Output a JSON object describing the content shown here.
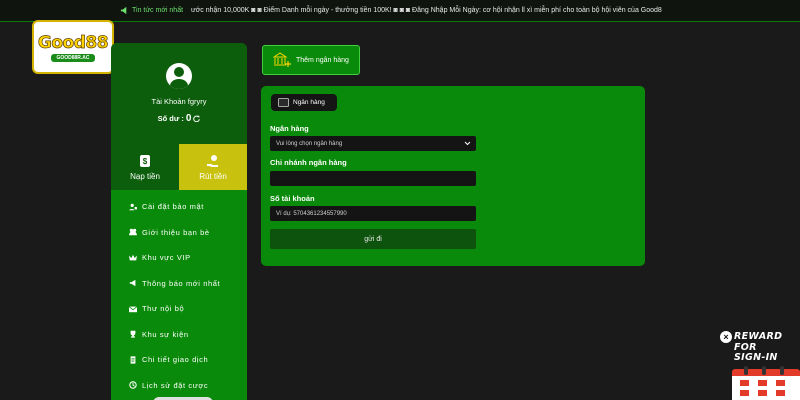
{
  "ticker": {
    "label": "Tin tức mới nhất",
    "text": "ước nhận 10,000K  ◙  ◙  Điểm Danh mỗi ngày - thưởng tiền 100K!  ◙  ◙  ◙  Đăng Nhập Mỗi Ngày: cơ hội nhận ll xì miễn phí cho toàn bộ hội viên của Good8"
  },
  "logo": {
    "main": "Good88",
    "sub": "GOOD88R.AC"
  },
  "profile": {
    "account_name": "Tài Khoản fgryry",
    "balance_label": "Số dư :",
    "balance_value": "0"
  },
  "actions": {
    "deposit": "Nạp tiền",
    "withdraw": "Rút tiền"
  },
  "menu": [
    {
      "id": "security",
      "label": "Cài đặt bảo mật",
      "icon": "user-lock-icon"
    },
    {
      "id": "referral",
      "label": "Giới thiệu bạn bè",
      "icon": "users-icon"
    },
    {
      "id": "vip",
      "label": "Khu vực VIP",
      "icon": "crown-icon"
    },
    {
      "id": "notifications",
      "label": "Thông báo mới nhất",
      "icon": "megaphone-icon"
    },
    {
      "id": "inbox",
      "label": "Thư nội bộ",
      "icon": "envelope-icon"
    },
    {
      "id": "events",
      "label": "Khu sự kiện",
      "icon": "trophy-icon"
    },
    {
      "id": "transactions",
      "label": "Chi tiết giao dịch",
      "icon": "receipt-icon"
    },
    {
      "id": "bet-history",
      "label": "Lịch sử đặt cược",
      "icon": "history-icon"
    }
  ],
  "add_bank": {
    "label": "Thêm ngân hàng"
  },
  "form": {
    "tab_label": "Ngân hàng",
    "bank_label": "Ngân hàng",
    "bank_select_value": "Vui lòng chọn ngân hàng",
    "branch_label": "Chi nhánh ngân hàng",
    "branch_value": "",
    "account_label": "Số tài khoản",
    "account_placeholder": "Ví dụ: 5704361234557990",
    "submit_label": "gửi đi"
  },
  "reward_banner": {
    "line1": "REWARD",
    "line2": "FOR",
    "line3": "SIGN-IN",
    "close": "×"
  },
  "colors": {
    "primary_green": "#0a8a0a",
    "dark_green": "#0c5e0c",
    "withdraw_yellow": "#c8c20e",
    "background": "#1a1a1a"
  }
}
